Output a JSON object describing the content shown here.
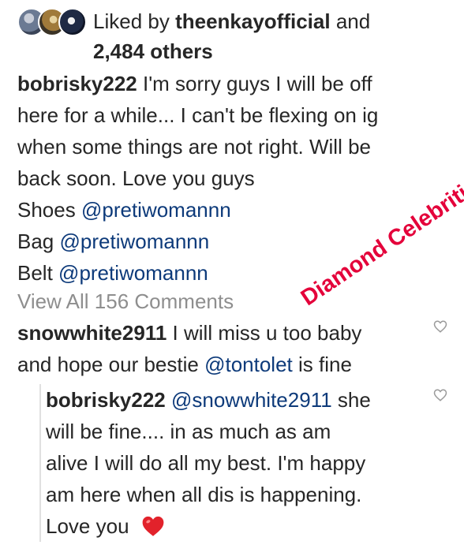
{
  "likes": {
    "prefix": "Liked by ",
    "user": "theenkayofficial",
    "suffix": " and",
    "count_text": "2,484 others"
  },
  "post": {
    "username": "bobrisky222",
    "lines": [
      "I'm sorry guys I will be off",
      "here for a while... I can't be flexing on ig",
      "when some things are not right. Will be",
      "back soon. Love you guys"
    ],
    "credits": [
      {
        "label": "Shoes",
        "mention": "@pretiwomannn"
      },
      {
        "label": "Bag",
        "mention": "@pretiwomannn"
      },
      {
        "label": "Belt",
        "mention": "@pretiwomannn"
      }
    ]
  },
  "view_all": "View All 156 Comments",
  "comment1": {
    "username": "snowwhite2911",
    "text_before": "I will miss u too baby",
    "text_line2": "and hope our bestie ",
    "mention": "@tontolet",
    "text_after": " is fine"
  },
  "reply": {
    "username": "bobrisky222",
    "mention": "@snowwhite2911",
    "text": [
      " she",
      "will be fine.... in as much as am",
      "alive I will do all my best. I'm happy",
      "am here when all dis is happening.",
      "Love you"
    ]
  },
  "watermark": "Diamond Celebrities",
  "colors": {
    "mention": "#0d3a7a",
    "watermark": "#e4003a",
    "muted": "#8e8e8e",
    "heart": "#e2222b"
  },
  "icons": [
    "heart-outline-icon",
    "red-heart-emoji"
  ]
}
